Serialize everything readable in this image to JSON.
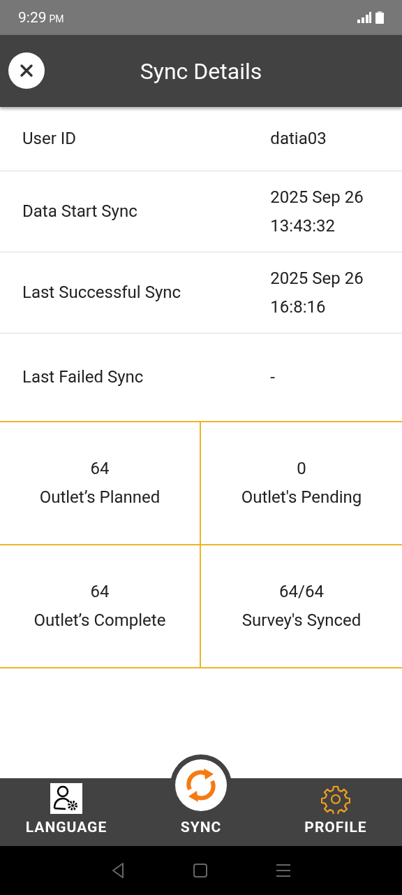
{
  "status_bar": {
    "time": "9:29",
    "meridiem": "PM"
  },
  "header": {
    "title": "Sync Details"
  },
  "details": [
    {
      "label": "User ID",
      "value": "datia03"
    },
    {
      "label": "Data Start Sync",
      "value": "2025 Sep 26 13:43:32"
    },
    {
      "label": "Last Successful Sync",
      "value": "2025 Sep 26 16:8:16"
    },
    {
      "label": "Last Failed Sync",
      "value": "-"
    }
  ],
  "stats": [
    {
      "count": "64",
      "label": "Outlet’s Planned"
    },
    {
      "count": "0",
      "label": "Outlet's Pending"
    },
    {
      "count": "64",
      "label": "Outlet’s Complete"
    },
    {
      "count": "64/64",
      "label": "Survey's Synced"
    }
  ],
  "bottom_nav": [
    {
      "kind": "language",
      "label": "LANGUAGE"
    },
    {
      "kind": "sync",
      "label": "SYNC"
    },
    {
      "kind": "profile",
      "label": "PROFILE"
    }
  ]
}
